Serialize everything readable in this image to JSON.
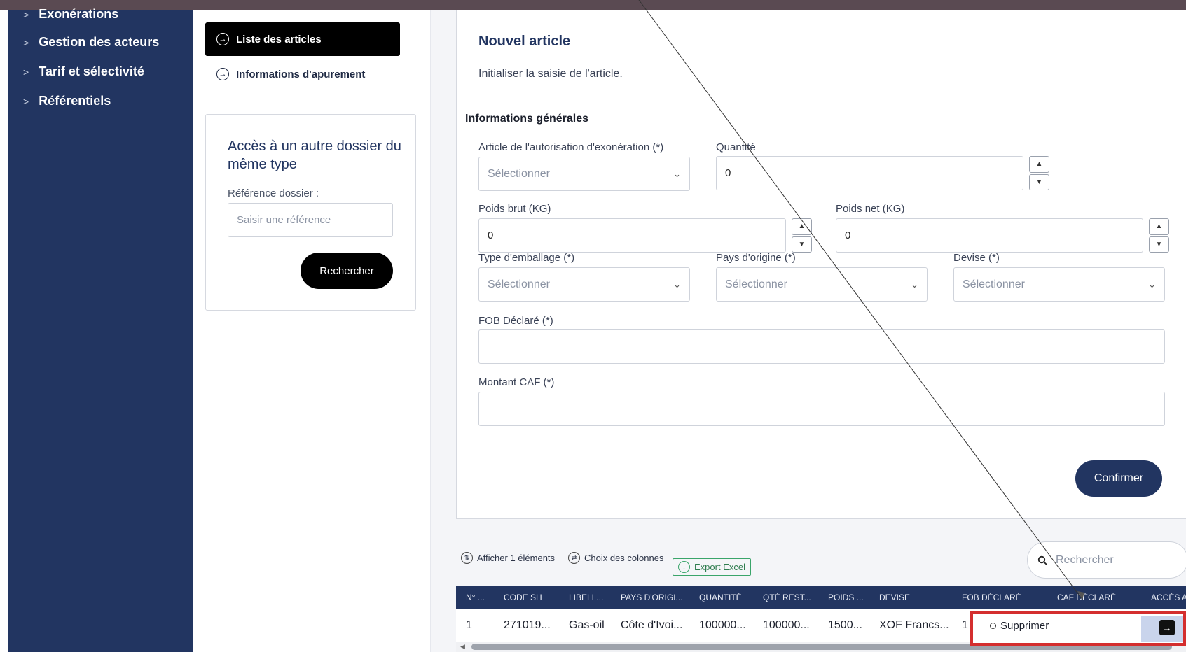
{
  "sidebar": {
    "items": [
      {
        "label": "Exonérations"
      },
      {
        "label": "Gestion des acteurs"
      },
      {
        "label": "Tarif et sélectivité"
      },
      {
        "label": "Référentiels"
      }
    ]
  },
  "nav": {
    "list_articles": "Liste des articles",
    "apurement": "Informations d'apurement"
  },
  "other_file": {
    "title": "Accès à un autre dossier du même type",
    "ref_label": "Référence dossier :",
    "ref_placeholder": "Saisir une référence",
    "search_button": "Rechercher"
  },
  "form": {
    "title": "Nouvel article",
    "subtitle": "Initialiser la saisie de l'article.",
    "section": "Informations générales",
    "article_label": "Article de l'autorisation d'exonération (*)",
    "article_value": "Sélectionner",
    "quantite_label": "Quantité",
    "quantite_value": "0",
    "poids_brut_label": "Poids brut (KG)",
    "poids_brut_value": "0",
    "poids_net_label": "Poids net (KG)",
    "poids_net_value": "0",
    "emballage_label": "Type d'emballage (*)",
    "emballage_value": "Sélectionner",
    "pays_label": "Pays d'origine (*)",
    "pays_value": "Sélectionner",
    "devise_label": "Devise (*)",
    "devise_value": "Sélectionner",
    "fob_label": "FOB Déclaré (*)",
    "fob_value": "",
    "caf_label": "Montant CAF (*)",
    "caf_value": "",
    "confirm_button": "Confirmer"
  },
  "toolbar": {
    "afficher": "Afficher 1 éléments",
    "colonnes": "Choix des colonnes",
    "export": "Export Excel",
    "search_placeholder": "Rechercher"
  },
  "table": {
    "headers": [
      "N° ...",
      "CODE SH",
      "LIBELL...",
      "PAYS D'ORIGI...",
      "QUANTITÉ",
      "QTÉ REST...",
      "POIDS ...",
      "DEVISE",
      "FOB DÉCLARÉ",
      "CAF DÉCLARÉ",
      "ACCÈS A..."
    ],
    "row": [
      "1",
      "271019...",
      "Gas-oil",
      "Côte d'Ivoi...",
      "100000...",
      "100000...",
      "1500...",
      "XOF Francs...",
      "1"
    ]
  },
  "popup": {
    "option": "Supprimer"
  },
  "icons": {
    "chevron": "chevron-right-icon",
    "circle_arrow": "circle-arrow-right-icon",
    "search": "search-icon",
    "arrow_right": "arrow-right-icon"
  }
}
